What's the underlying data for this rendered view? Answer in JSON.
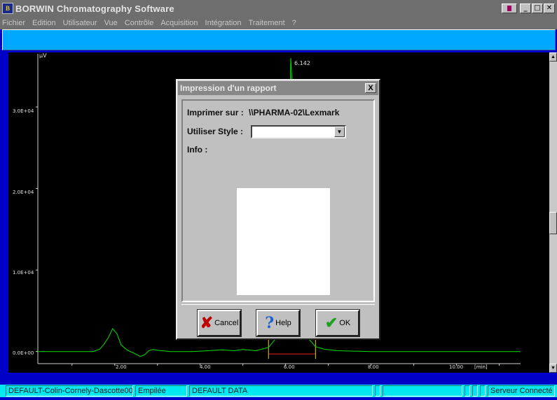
{
  "window": {
    "title": "BORWIN Chromatography Software",
    "icon_text": "B"
  },
  "menu": [
    "Fichier",
    "Edition",
    "Utilisateur",
    "Vue",
    "Contrôle",
    "Acquisition",
    "Intégration",
    "Traitement",
    "?"
  ],
  "chart_data": {
    "type": "line",
    "ylabel": "µV",
    "xlabel_unit": "[min]",
    "y_ticks": [
      "0.0E+00",
      "1.0E+04",
      "2.0E+04",
      "3.0E+04"
    ],
    "x_ticks": [
      "2.00",
      "4.00",
      "6.00",
      "8.00",
      "10.00"
    ],
    "peak_label": "6.142",
    "xlim": [
      0.2,
      11.5
    ],
    "ylim": [
      -800,
      36000
    ],
    "series": [
      {
        "color": "#00e000",
        "x": [
          0.2,
          1.5,
          1.65,
          1.75,
          1.85,
          1.95,
          2.05,
          2.15,
          2.3,
          2.45,
          2.6,
          2.7,
          2.8,
          2.9,
          3.0,
          3.3,
          3.8,
          4.2,
          4.5,
          4.8,
          5.0,
          5.3,
          5.6,
          5.8,
          5.95,
          6.05,
          6.12,
          6.18,
          6.25,
          6.35,
          6.45,
          6.55,
          6.7,
          6.9,
          7.2,
          8.0,
          9.0,
          10.0,
          11.5
        ],
        "y": [
          0,
          0,
          300,
          900,
          1700,
          2800,
          2200,
          800,
          150,
          -200,
          -600,
          -400,
          100,
          250,
          150,
          0,
          0,
          100,
          200,
          100,
          250,
          100,
          500,
          1800,
          6000,
          16000,
          36000,
          30000,
          14000,
          6000,
          3000,
          1500,
          600,
          300,
          100,
          0,
          0,
          0,
          0
        ]
      }
    ],
    "markers": [
      {
        "x": 5.6,
        "color": "#f0d000"
      },
      {
        "x": 6.7,
        "color": "#f0d000"
      }
    ],
    "baseline": {
      "x_start": 5.6,
      "x_end": 6.7,
      "color": "#e02020"
    }
  },
  "dialog": {
    "title": "Impression d'un rapport",
    "close_label": "X",
    "printer_label": "Imprimer sur :",
    "printer_value": "\\\\PHARMA-02\\Lexmark",
    "style_label": "Utiliser Style :",
    "style_value": "",
    "info_label": "Info :",
    "buttons": {
      "cancel": "Cancel",
      "help": "Help",
      "ok": "OK"
    }
  },
  "statusbar": [
    "DEFAULT-Colin-Cornely-Dascotte00",
    "Empilée",
    "DEFAULT DATA",
    "",
    "",
    "",
    "",
    "",
    "Serveur Connecté"
  ]
}
